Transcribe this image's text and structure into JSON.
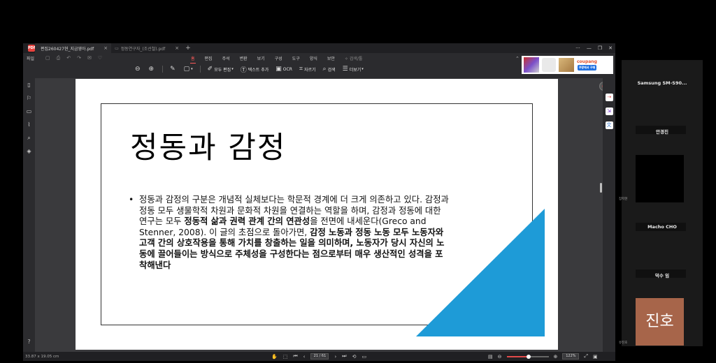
{
  "app": {
    "logo_text": "PDF",
    "tabs": [
      {
        "label": "편집260427현_지금영아.pdf",
        "close": "×"
      },
      {
        "label": "정동연구자_(조선철).pdf",
        "close": "×"
      }
    ],
    "add_tab": "+",
    "window_controls": [
      "···",
      "—",
      "❐",
      "✕"
    ]
  },
  "menubar": {
    "file": "파일",
    "tabs": [
      "홈",
      "편집",
      "주석",
      "변환",
      "보기",
      "구성",
      "도구",
      "양식",
      "보안"
    ],
    "active_tab": "홈",
    "search_tool": "✧ 검색/툴"
  },
  "ad": {
    "brand": "coupang",
    "cta": "쿠팡에서 구매"
  },
  "toolbar": {
    "zoom_out": "⊖",
    "zoom_in": "⊕",
    "edit_all": "모두 편집",
    "add_text": "텍스트 추가",
    "ocr": "OCR",
    "crop": "자르기",
    "search": "검색",
    "more": "더보기"
  },
  "slide": {
    "title": "정동과 감정",
    "bullet": "•",
    "body_parts": [
      {
        "text": "정동과 감정의 구분은 개념적 실체보다는 학문적 경계에 더 크게 의존하고 있다. 감정과 정동 모두 생물학적 차원과 문화적 차원을 연결하는 역할을 하며, 감정과 정동에 대한 연구는 모두 ",
        "bold": false
      },
      {
        "text": "정동적 삶과 권력 관계 간의 연관성",
        "bold": true
      },
      {
        "text": "을 전면에 내세운다(Greco and Stenner, 2008). 이 글의 초점으로 돌아가면, ",
        "bold": false
      },
      {
        "text": "감정 노동과 정동 노동 모두 노동자와 고객 간의 상호작용을 통해 가치를 창출하는 일을 의미하며, 노동자가 당시 자신의 노동에 끌어들이는 방식으로 주체성을 구성한다는 점으로부터 매우 생산적인 성격을 포착해낸다",
        "bold": true
      }
    ],
    "accent_color": "#1e9bd7"
  },
  "statusbar": {
    "page_size": "33.87 x 19.05 cm",
    "page_indicator": "21 / 61",
    "zoom": "122%"
  },
  "participants": {
    "device": "Samsung  SM-S90...",
    "names": [
      "안경진",
      "Macho CHO",
      "덕수 임"
    ],
    "small_labels": [
      "장지현",
      "유진호"
    ],
    "avatar_text": "진호",
    "avatar_color": "#a7654a"
  }
}
